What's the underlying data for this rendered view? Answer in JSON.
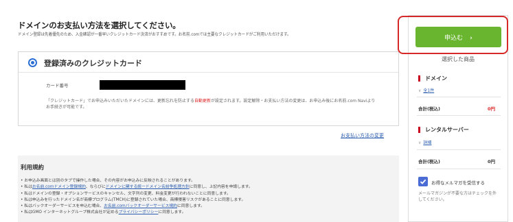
{
  "page": {
    "title": "ドメインのお支払い方法を選択してください。",
    "subtitle": "ドメイン登録は先着優先のため、入金確認が一番早いクレジットカード決済がおすすめです。お名前.comでは主要なクレジットカードがご利用いただけます。"
  },
  "payment": {
    "option_label": "登録済みのクレジットカード",
    "card_label": "カード番号",
    "note_prefix": "「クレジットカード」でお申込みいただいたドメインには、更新忘れを防止する",
    "note_highlight": "自動更新",
    "note_suffix": "が設定されます。設定解除・お支払い方法の変更は、お申込み後にお名前.com Naviよりお手続きが可能です。",
    "change_link": "お支払い方法の変更"
  },
  "terms": {
    "title": "利用規約",
    "items": [
      {
        "pre": "お申込み画面とは別のタブで操作した場合、その内容がお申込みに反映されることがあります。",
        "link": "",
        "mid": "",
        "link2": "",
        "post": ""
      },
      {
        "pre": "私は",
        "link": "お名前.comドメイン登録規約",
        "mid": "、ならびに",
        "link2": "ドメインに関する統一ドメイン名紛争処理方針",
        "post": "に同意し、上記内容を申請します。"
      },
      {
        "pre": "私はドメインの登録・オプションサービスのキャンセル、文字列の変更、料金変更が行われないことに同意します。",
        "link": "",
        "mid": "",
        "link2": "",
        "post": ""
      },
      {
        "pre": "私は申込みを行ったドメイン名が商標プログラム(TMCH)に登録されていた場合、商標侵害リスクがあることに同意します。",
        "link": "",
        "mid": "",
        "link2": "",
        "post": ""
      },
      {
        "pre": "私はバックオーダーサービスを申込む場合、",
        "link": "お名前.comバックオーダーサービス規約",
        "mid": "に同意します。",
        "link2": "",
        "post": ""
      },
      {
        "pre": "私はGMO インターネットグループ株式会社が定める",
        "link": "プライバシーポリシー",
        "mid": "に同意します。",
        "link2": "",
        "post": ""
      }
    ]
  },
  "sidebar": {
    "apply_label": "申込む",
    "apply_chevron": "›",
    "selected_title": "選択した商品",
    "domain_section": "ドメイン",
    "domain_link": "全1件",
    "subtotal_label": "合計(税込)",
    "domain_total": "0円",
    "server_section": "レンタルサーバー",
    "server_link": "詳細",
    "server_total": "0円",
    "magazine_label": "お得なメルマガを受信する",
    "magazine_checked": true,
    "magazine_note": "メールマガジンが不要な方はチェックを外してください。"
  },
  "colors": {
    "accent_green": "#69b52f",
    "highlight_red": "#d62828",
    "section_bar_red": "#c9001e",
    "link_blue": "#2a5db0",
    "radio_blue": "#2b6fd6",
    "total_red": "#d22"
  }
}
